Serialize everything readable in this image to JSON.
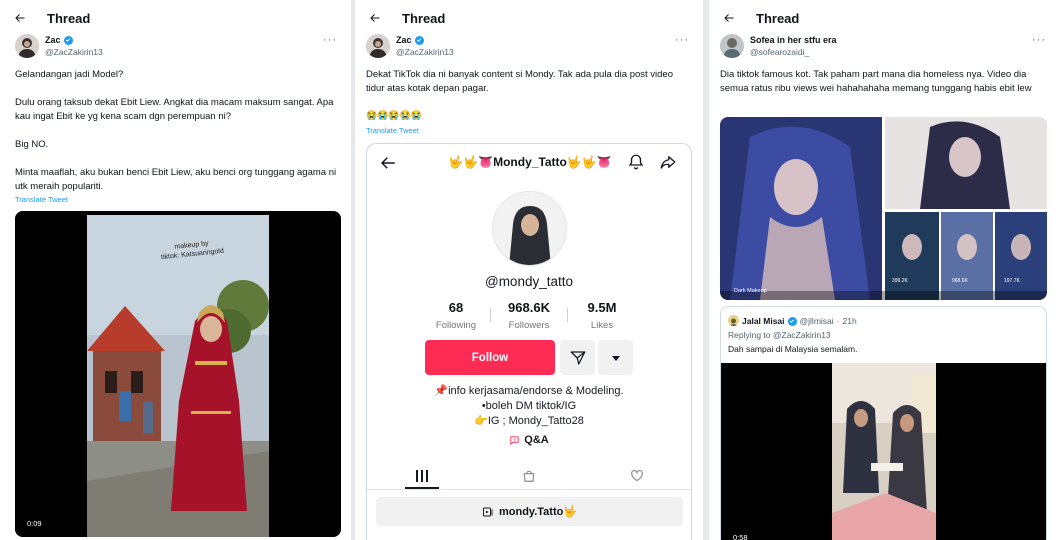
{
  "panels": [
    {
      "header": "Thread",
      "user": {
        "name": "Zac",
        "handle": "@ZacZakirin13"
      },
      "text": "Gelandangan jadi Model?\n\nDulu orang taksub dekat Ebit Liew. Angkat dia macam maksum sangat. Apa kau ingat Ebit ke yg kena scam dgn perempuan ni?\n\nBig NO.\n\nMinta maaflah, aku bukan benci Ebit Liew, aku benci org tunggang agama ni utk meraih populariti.",
      "translate": "Translate Tweet",
      "video": {
        "overlay_line1": "makeup by",
        "overlay_line2": "tiktok: Katsuaringold",
        "duration": "0:09"
      }
    },
    {
      "header": "Thread",
      "user": {
        "name": "Zac",
        "handle": "@ZacZakirin13"
      },
      "text": "Dekat TikTok dia ni banyak content si Mondy. Tak ada pula dia post video tidur atas kotak depan pagar.",
      "emojis": "😭😭😭😭😭",
      "translate": "Translate Tweet",
      "tiktok": {
        "profile_name": "🤟🤟👅Mondy_Tatto🤟🤟👅",
        "username": "@mondy_tatto",
        "stats": [
          {
            "value": "68",
            "label": "Following"
          },
          {
            "value": "968.6K",
            "label": "Followers"
          },
          {
            "value": "9.5M",
            "label": "Likes"
          }
        ],
        "follow_label": "Follow",
        "bio_line1": "📌info kerjasama/endorse & Modeling.",
        "bio_line2": "•boleh DM tiktok/IG",
        "bio_line3": "👉IG ; Mondy_Tatto28",
        "qa_label": "Q&A",
        "playlist_label": "mondy.Tatto🤟"
      }
    },
    {
      "header": "Thread",
      "user": {
        "name": "Sofea in her stfu era",
        "handle": "@sofearozaidi_"
      },
      "text": "Dia tiktok famous kot. Tak paham part mana dia homeless nya. Video dia semua ratus ribu views wei hahahahaha memang tunggang habis ebit lew",
      "collage": {
        "main_label": "Dark Makeup",
        "counts": [
          "399.2K",
          "968.6K",
          "197.7K"
        ]
      },
      "quote": {
        "name": "Jalal Misai",
        "handle": "@jllmisai",
        "time": "21h",
        "replying": "Replying to @ZacZakirin13",
        "text": "Dah sampai di Malaysia semalam.",
        "duration": "0:58"
      }
    }
  ]
}
